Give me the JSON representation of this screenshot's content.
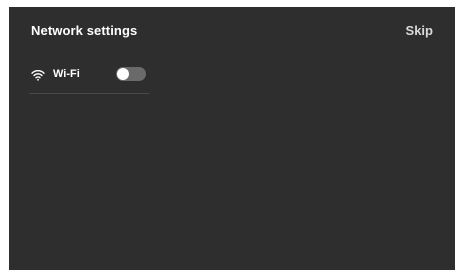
{
  "header": {
    "title": "Network settings",
    "skip_label": "Skip"
  },
  "wifi": {
    "label": "Wi-Fi",
    "icon": "wifi-icon",
    "enabled": false
  },
  "colors": {
    "background": "#2e2e2e",
    "text": "#ffffff",
    "toggle_off": "#6a6a6a"
  }
}
